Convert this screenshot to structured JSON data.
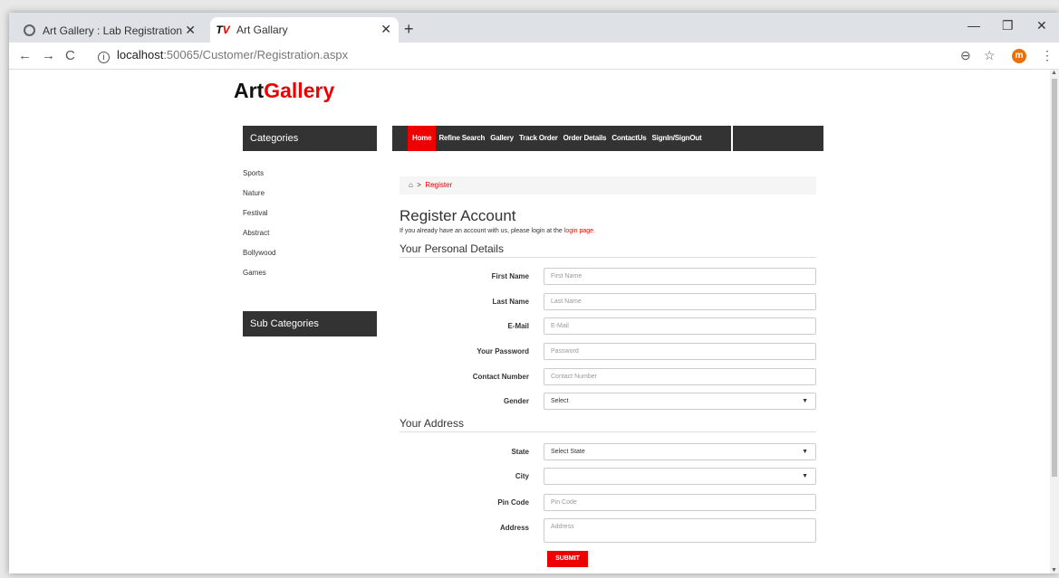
{
  "browser": {
    "tabs": [
      {
        "title": "Art Gallery : Lab Registration",
        "active": false
      },
      {
        "title": "Art Gallary",
        "active": true
      }
    ],
    "url_host": "localhost",
    "url_path": ":50065/Customer/Registration.aspx",
    "profile_initial": "m"
  },
  "site": {
    "logo_a": "Art",
    "logo_b": "Gallery",
    "categories_title": "Categories",
    "categories": [
      "Sports",
      "Nature",
      "Festival",
      "Abstract",
      "Bollywood",
      "Games"
    ],
    "subcategories_title": "Sub Categories",
    "menu": [
      "Home",
      "Refine Search",
      "Gallery",
      "Track Order",
      "Order Details",
      "ContactUs",
      "SignIn/SignOut"
    ]
  },
  "page": {
    "breadcrumb_current": "Register",
    "title": "Register Account",
    "subtitle_text": "If you already have an account with us, please login at the",
    "subtitle_link": "login page.",
    "section_personal": "Your Personal Details",
    "section_address": "Your Address",
    "fields": {
      "first_name": {
        "label": "First Name",
        "placeholder": "First Name"
      },
      "last_name": {
        "label": "Last Name",
        "placeholder": "Last Name"
      },
      "email": {
        "label": "E-Mail",
        "placeholder": "E-Mail"
      },
      "password": {
        "label": "Your Password",
        "placeholder": "Password"
      },
      "contact": {
        "label": "Contact Number",
        "placeholder": "Contact Number"
      },
      "gender": {
        "label": "Gender",
        "value": "Select"
      },
      "state": {
        "label": "State",
        "value": "Select State"
      },
      "city": {
        "label": "City",
        "value": ""
      },
      "pincode": {
        "label": "Pin Code",
        "placeholder": "Pin Code"
      },
      "address": {
        "label": "Address",
        "placeholder": "Address"
      }
    },
    "submit_label": "SUBMIT"
  }
}
